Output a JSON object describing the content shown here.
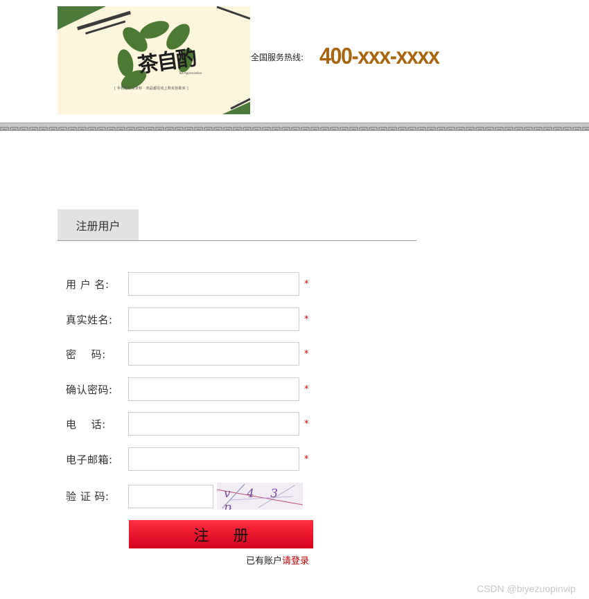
{
  "header": {
    "logo": {
      "brand": "茶自酌",
      "sub": "Tea Appreciation",
      "slogan": "[ 手机轻松采茶籽 · 商品都在线上购买自助买 ]"
    },
    "hotline_label": "全国服务热线:",
    "hotline_number": "400-xxx-xxxx"
  },
  "tab": {
    "label": "注册用户"
  },
  "form": {
    "fields": [
      {
        "label": "用 户 名:",
        "value": "",
        "required_mark": "*"
      },
      {
        "label": "真实姓名:",
        "value": "",
        "required_mark": "*"
      },
      {
        "label": "密    码:",
        "value": "",
        "required_mark": "*"
      },
      {
        "label": "确认密码:",
        "value": "",
        "required_mark": "*"
      },
      {
        "label": "电    话:",
        "value": "",
        "required_mark": "*"
      },
      {
        "label": "电子邮箱:",
        "value": "",
        "required_mark": "*"
      }
    ],
    "captcha": {
      "label": "验 证 码:",
      "value": "",
      "image_text": "v 4 3 p"
    },
    "submit_label": "注 册",
    "login_hint": "已有账户",
    "login_link": "请登录"
  },
  "watermark": "CSDN @biyezuopinvip",
  "colors": {
    "accent_red": "#e50f24",
    "hotline_color": "#a8650f",
    "logo_green": "#4b7a3a",
    "required_color": "#cc0000"
  }
}
